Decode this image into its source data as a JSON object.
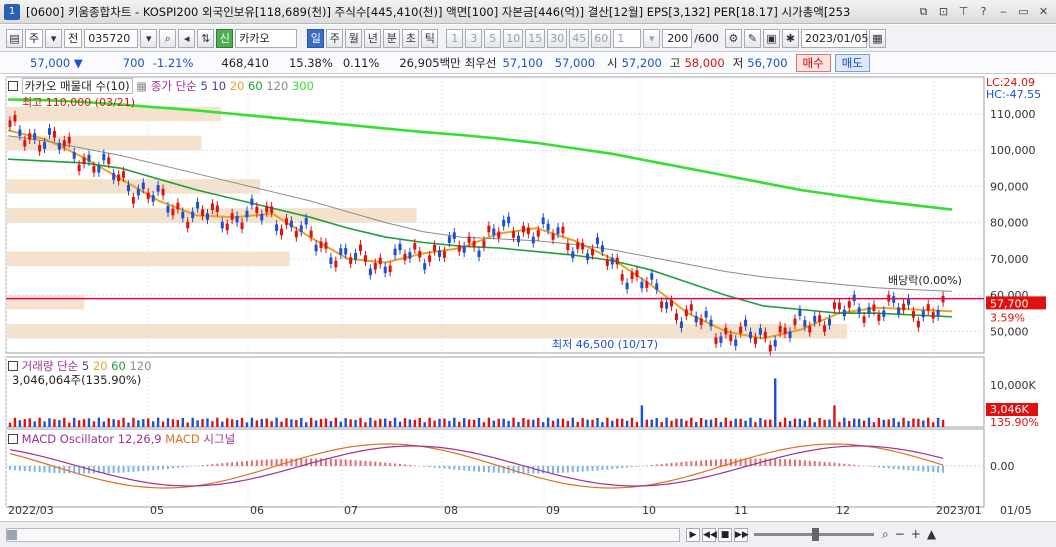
{
  "window": {
    "number": "1",
    "title": "[0600] 키움종합차트 - KOSPI200 외국인보유[118,689(천)] 주식수[445,410(천)] 액면[100] 자본금[446(억)] 결산[12월] EPS[3,132] PER[18.17] 시가총액[253"
  },
  "toolbar": {
    "period": "주",
    "market": "전",
    "code": "035720",
    "badge": "신",
    "name": "카카오",
    "intervals": [
      "일",
      "주",
      "월",
      "년",
      "분",
      "초",
      "틱"
    ],
    "minutes": [
      "1",
      "3",
      "5",
      "10",
      "15",
      "30",
      "45",
      "60"
    ],
    "minute_sel": "1",
    "count": "200",
    "count_max": "/600",
    "date": "2023/01/05"
  },
  "quote": {
    "price": "57,000 ▼",
    "change": "700",
    "change_pct": "-1.21%",
    "volume": "468,410",
    "turnover_pct": "15.38%",
    "vol_pct": "0.11%",
    "amount": "26,905백만",
    "best_ask_label": "최우선",
    "best_ask": "57,100",
    "best_bid": "57,000",
    "open_label": "시",
    "open": "57,200",
    "high_label": "고",
    "high": "58,000",
    "low_label": "저",
    "low": "56,700",
    "buy": "매수",
    "sell": "매도"
  },
  "price_panel": {
    "item": "카카오 매물대 수(10)",
    "ma_label": "종가 단순",
    "ma_periods": [
      "5",
      "10",
      "20",
      "60",
      "120",
      "300"
    ],
    "lc": "LC:24.09",
    "hc": "HC:-47.55",
    "max_note": "최고 110,000 (03/21)",
    "min_note": "최저 46,500 (10/17)",
    "dividend_note": "배당락(0.00%)",
    "last_price": "57,700",
    "last_pct": "3.59%"
  },
  "volume_panel": {
    "label": "거래량",
    "ma_label": "단순",
    "ma_periods": [
      "5",
      "20",
      "60",
      "120"
    ],
    "value": "3,046,064주(135.90%)",
    "last": "3,046K",
    "last_pct": "135.90%"
  },
  "macd_panel": {
    "label": "MACD Oscillator 12,26,9",
    "macd": "MACD",
    "signal": "시그널",
    "zero": "0.00"
  },
  "axis": {
    "x_labels": [
      "2022/03",
      "05",
      "06",
      "07",
      "08",
      "09",
      "10",
      "11",
      "12",
      "2023/01",
      "01/05"
    ],
    "y_price": [
      "110,000",
      "100,000",
      "90,000",
      "80,000",
      "70,000",
      "60,000",
      "50,000"
    ],
    "y_volume": [
      "10,000K"
    ],
    "y_macd": [
      "0.00"
    ]
  },
  "colors": {
    "up": "#e01010",
    "down": "#1a4fd6",
    "ma5": "#3f3fa8",
    "ma20": "#f0a020",
    "ma60": "#1fa03a",
    "ma120": "#8a8a8a",
    "ma300": "#33e030",
    "volume_profile": "#f5e2cc"
  },
  "chart_data": {
    "type": "line",
    "title": "카카오 매물대 수(10)",
    "x_range": [
      "2022/03",
      "2023/01/05"
    ],
    "ylim": [
      44000,
      118000
    ],
    "series": [
      {
        "name": "종가 단순 20",
        "values": [
          105500,
          103000,
          98000,
          92000,
          86000,
          82000,
          81500,
          82500,
          76000,
          70000,
          69000,
          71500,
          73000,
          77000,
          78500,
          75000,
          70000,
          63000,
          55000,
          50000,
          48000,
          50500,
          55000,
          56500,
          56000,
          55500
        ]
      },
      {
        "name": "종가 단순 60",
        "values": [
          97500,
          97000,
          96500,
          95000,
          92000,
          89000,
          86500,
          84000,
          81500,
          78500,
          76000,
          74500,
          73500,
          73000,
          72000,
          71000,
          69500,
          67000,
          63500,
          60000,
          57000,
          56000,
          55000,
          55000,
          54500,
          54000
        ]
      },
      {
        "name": "종가 단순 120",
        "values": [
          104000,
          102500,
          100500,
          98500,
          96000,
          93500,
          91000,
          88500,
          86000,
          83000,
          80000,
          77500,
          76000,
          75500,
          75000,
          74000,
          72500,
          70500,
          68500,
          66500,
          65000,
          64000,
          63000,
          62000,
          61500,
          61000
        ]
      },
      {
        "name": "종가 단순 300",
        "values": [
          114000,
          113800,
          113300,
          112600,
          111800,
          111000,
          110000,
          109000,
          108000,
          107000,
          106000,
          105000,
          104200,
          103200,
          102000,
          100500,
          99000,
          97000,
          95000,
          93000,
          91000,
          89000,
          87500,
          86000,
          84800,
          83600
        ]
      }
    ],
    "annotations": [
      "최고 110,000 (03/21)",
      "최저 46,500 (10/17)",
      "배당락(0.00%)"
    ],
    "ohlc_last": {
      "open": 57200,
      "high": 58000,
      "low": 56700,
      "close": 57700
    }
  }
}
